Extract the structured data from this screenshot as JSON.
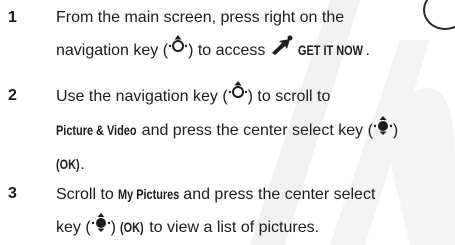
{
  "steps": [
    {
      "number": "1",
      "line1": "From the main screen, press right on the",
      "line2_pre": "navigation key (",
      "line2_mid": ") to access ",
      "app_label": "GET IT NOW",
      "line2_end": "."
    },
    {
      "number": "2",
      "line1_pre": "Use the navigation key (",
      "line1_post": ") to scroll to",
      "menu_item": "Picture & Video",
      "line2_mid": " and press the center select key (",
      "line2_end": ")",
      "ok_label": "(OK)",
      "line3_end": "."
    },
    {
      "number": "3",
      "line1_pre": "Scroll to ",
      "menu_item": "My Pictures",
      "line1_post": " and press the center select",
      "line2_pre": "key (",
      "line2_mid": ") ",
      "ok_label": "(OK)",
      "line2_end": " to view a list of pictures."
    }
  ],
  "icons": {
    "nav_key": "navigation-key-icon",
    "select_key": "center-select-key-icon",
    "get_it_now": "get-it-now-icon"
  }
}
